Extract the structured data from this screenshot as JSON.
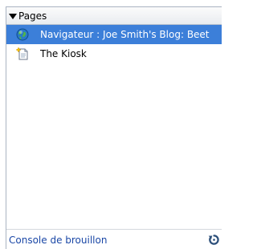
{
  "panel": {
    "title": "Pages",
    "items": [
      {
        "label": "Navigateur : Joe Smith's Blog: Beet",
        "icon": "globe-icon",
        "selected": true
      },
      {
        "label": "The Kiosk",
        "icon": "new-page-sparkle-icon",
        "selected": false
      }
    ]
  },
  "footer": {
    "link_label": "Console de brouillon",
    "refresh_icon": "refresh-icon"
  },
  "colors": {
    "selection": "#3c7fd9",
    "link": "#1a47a6",
    "border": "#aab4c2"
  }
}
